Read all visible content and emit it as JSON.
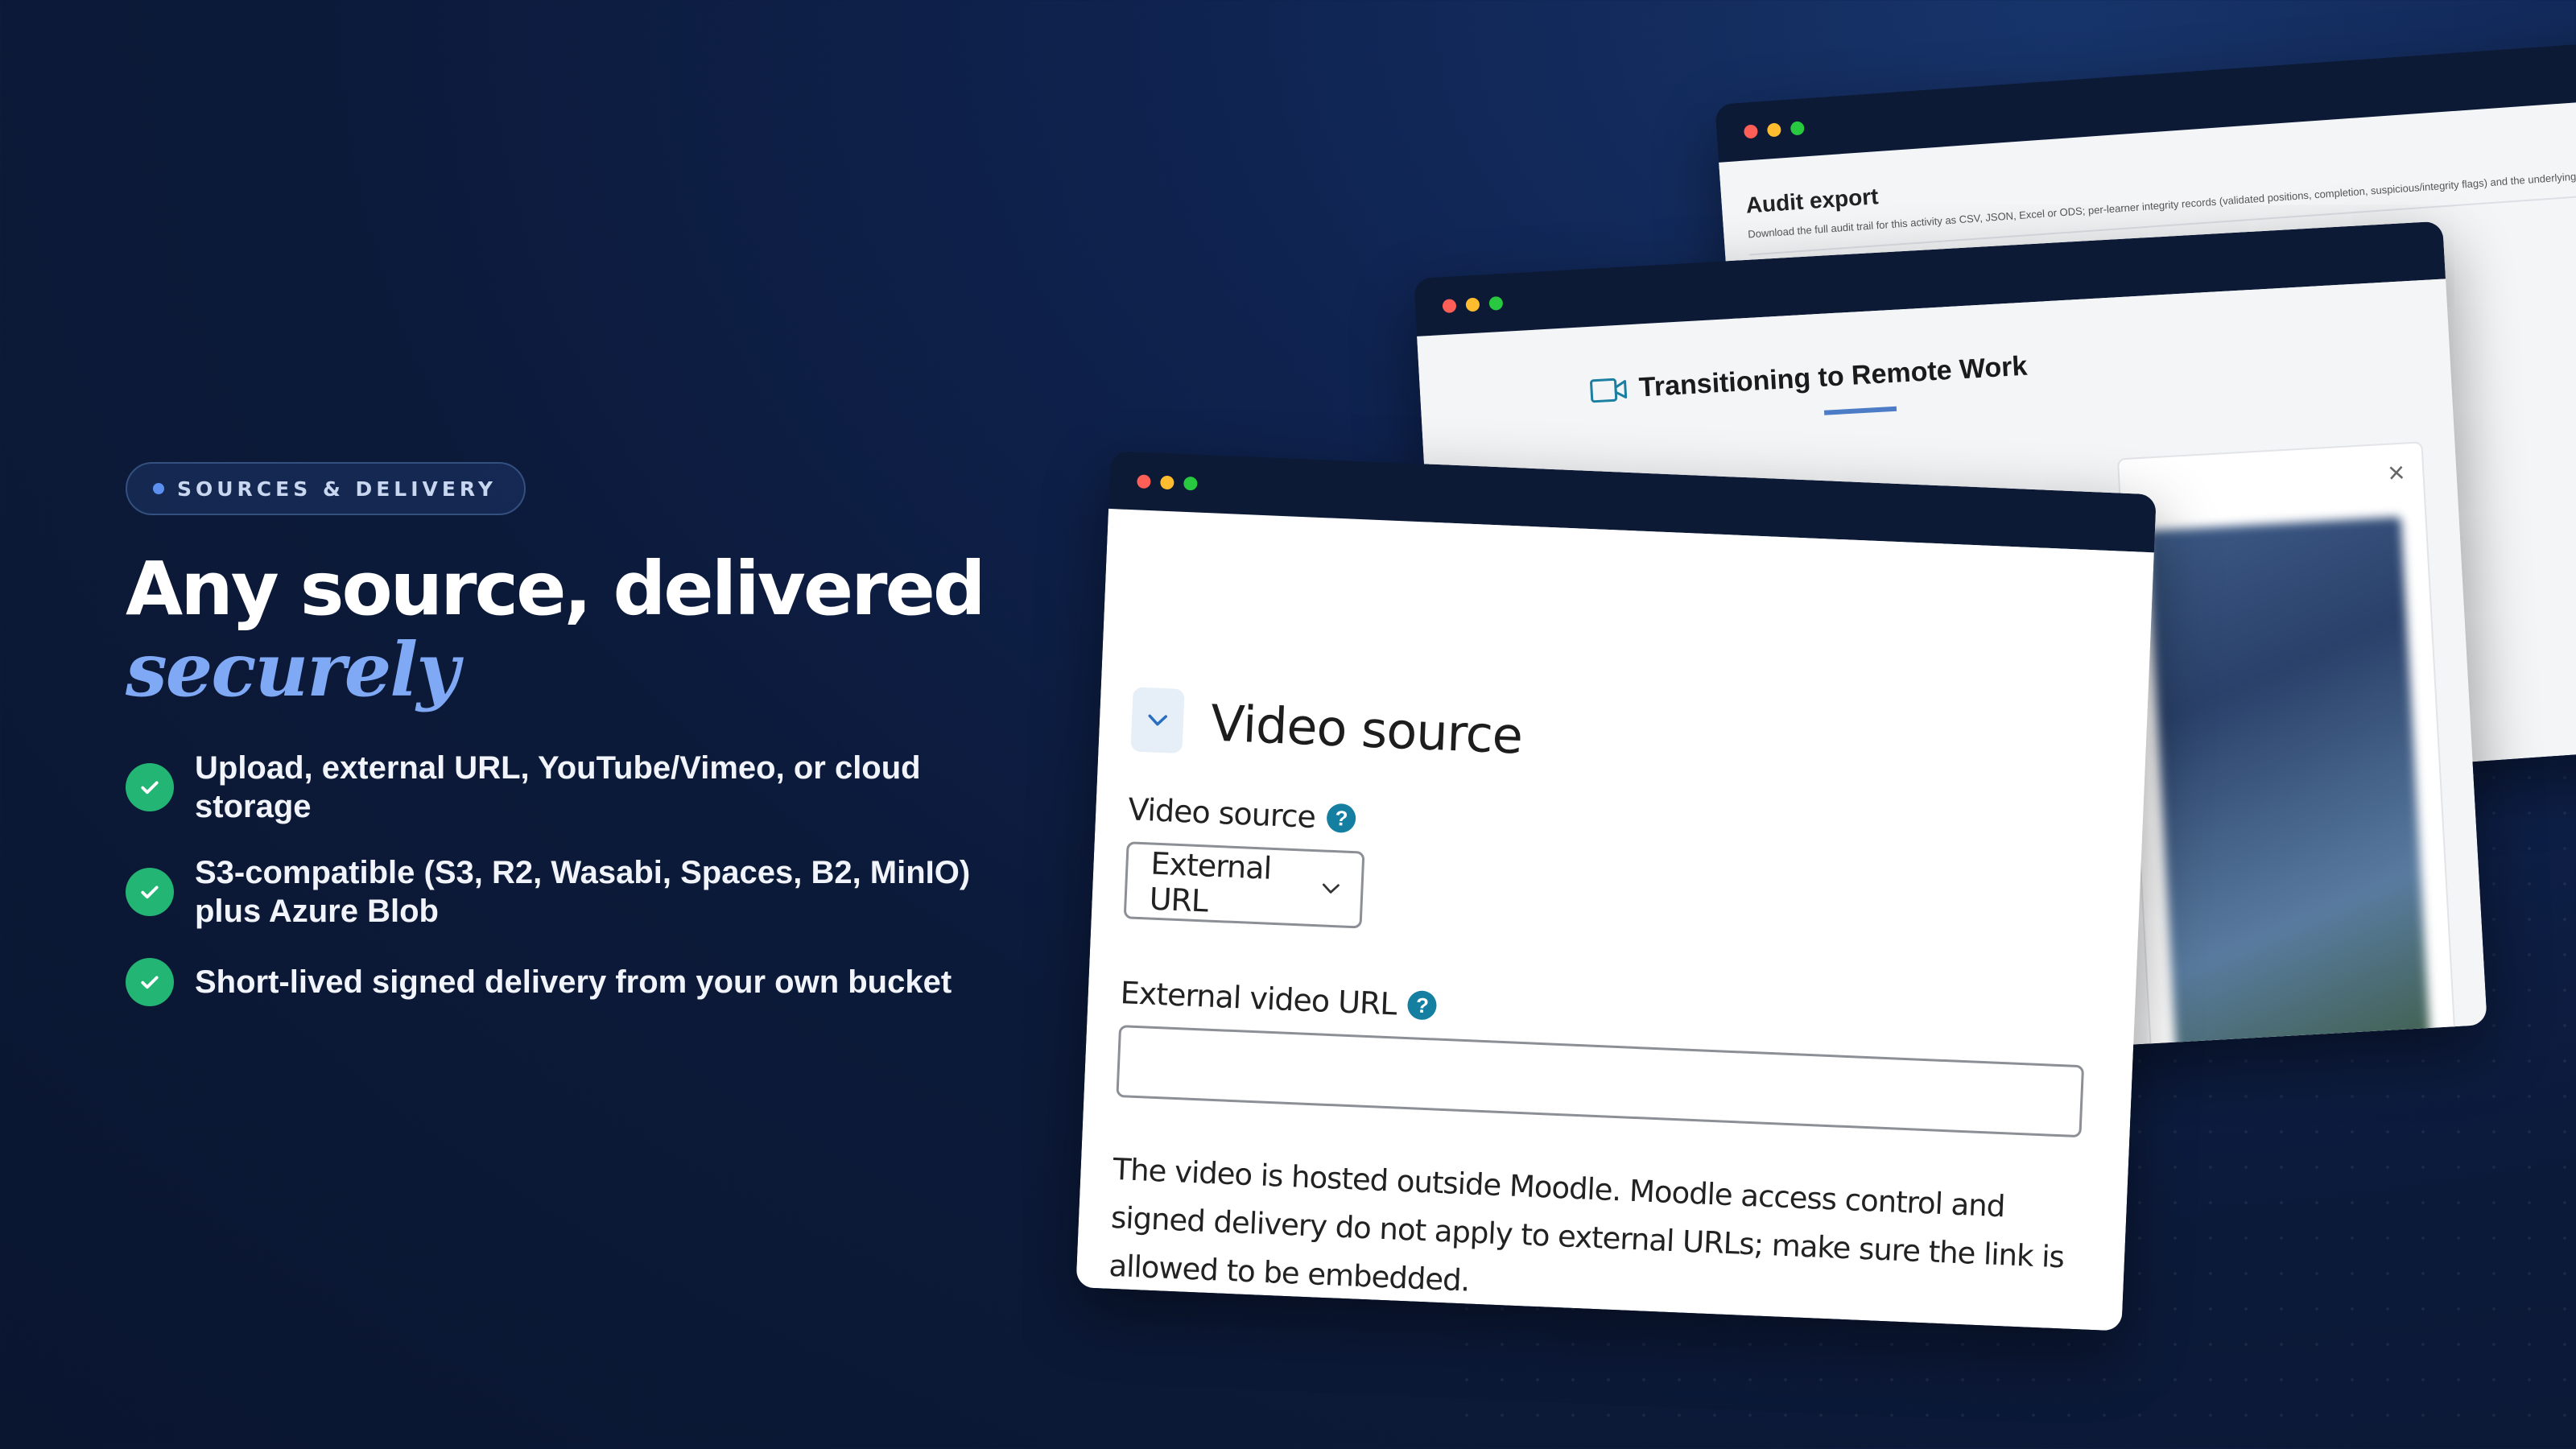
{
  "badge": {
    "label": "SOURCES & DELIVERY"
  },
  "headline": {
    "line1": "Any source, delivered",
    "emphasis": "securely"
  },
  "features": [
    {
      "text": "Upload, external URL, YouTube/Vimeo, or cloud storage"
    },
    {
      "text": "S3-compatible (S3, R2, Wasabi, Spaces, B2, MinIO) plus Azure Blob"
    },
    {
      "text": "Short-lived signed delivery from your own bucket"
    }
  ],
  "back_window": {
    "title": "Audit export",
    "description": "Download the full audit trail for this activity as CSV, JSON, Excel or ODS; per-learner integrity records (validated positions, completion, suspicious/integrity flags) and the underlying val"
  },
  "mid_window": {
    "course_title": "Transitioning to Remote Work",
    "close_glyph": "×"
  },
  "front_window": {
    "section_title": "Video source",
    "video_source_label": "Video source",
    "video_source_value": "External URL",
    "external_url_label": "External video URL",
    "external_url_value": "",
    "help_glyph": "?",
    "help_text": "The video is hosted outside Moodle. Moodle access control and signed delivery do not apply to external URLs; make sure the link is allowed to be embedded."
  },
  "colors": {
    "accent_blue": "#7fa8f5",
    "check_green": "#22b573",
    "help_teal": "#157fa2",
    "window_bar": "#0c1a36"
  },
  "icons": {
    "badge_dot": "dot-icon",
    "feature_check": "check-circle-icon",
    "collapse": "chevron-down-icon",
    "select_arrow": "chevron-down-icon",
    "help": "question-circle-icon",
    "course": "video-camera-icon",
    "close": "close-icon"
  }
}
